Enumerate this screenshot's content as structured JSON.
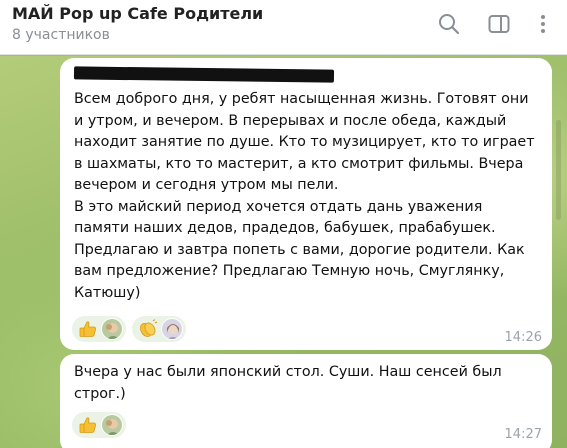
{
  "header": {
    "title": "МАЙ Pop up Cafe Родители",
    "subtitle": "8 участников",
    "icons": [
      "search-icon",
      "sidebar-toggle-icon",
      "more-vert-icon"
    ]
  },
  "messages": [
    {
      "text": "Всем доброго дня, у ребят насыщенная жизнь. Готовят они\nи утром, и вечером. В перерывах и  после обеда, каждый\nнаходит занятие по душе. Кто то музицирует, кто то играет\nв шахматы, кто то мастерит, а кто смотрит фильмы.  Вчера\nвечером и сегодня утром мы пели.\nВ это майский период хочется отдать дань уважения\nпамяти наших дедов, прадедов, бабушек, прабабушек.\nПредлагаю и завтра попеть с вами, дорогие родители. Как\nвам предложение?  Предлагаю Темную ночь, Смуглянку,\nКатюшу)",
      "time": "14:26",
      "reactions": [
        {
          "emoji": "thumbs-up-icon",
          "avatar": "avatar-child-1"
        },
        {
          "emoji": "clapping-hands-icon",
          "avatar": "avatar-child-2"
        }
      ]
    },
    {
      "text": "Вчера у нас были японский стол. Суши. Наш сенсей был\nстрог.)",
      "time": "14:27",
      "reactions": [
        {
          "emoji": "thumbs-up-icon",
          "avatar": "avatar-child-1"
        }
      ]
    }
  ],
  "colors": {
    "header_bg": "#ffffff",
    "chat_bg": "#9fbf6e",
    "bubble_bg": "#ffffff",
    "reaction_bg": "#ebf2e6",
    "time_color": "#9ba4ab",
    "subtitle_color": "#8a8f96"
  }
}
